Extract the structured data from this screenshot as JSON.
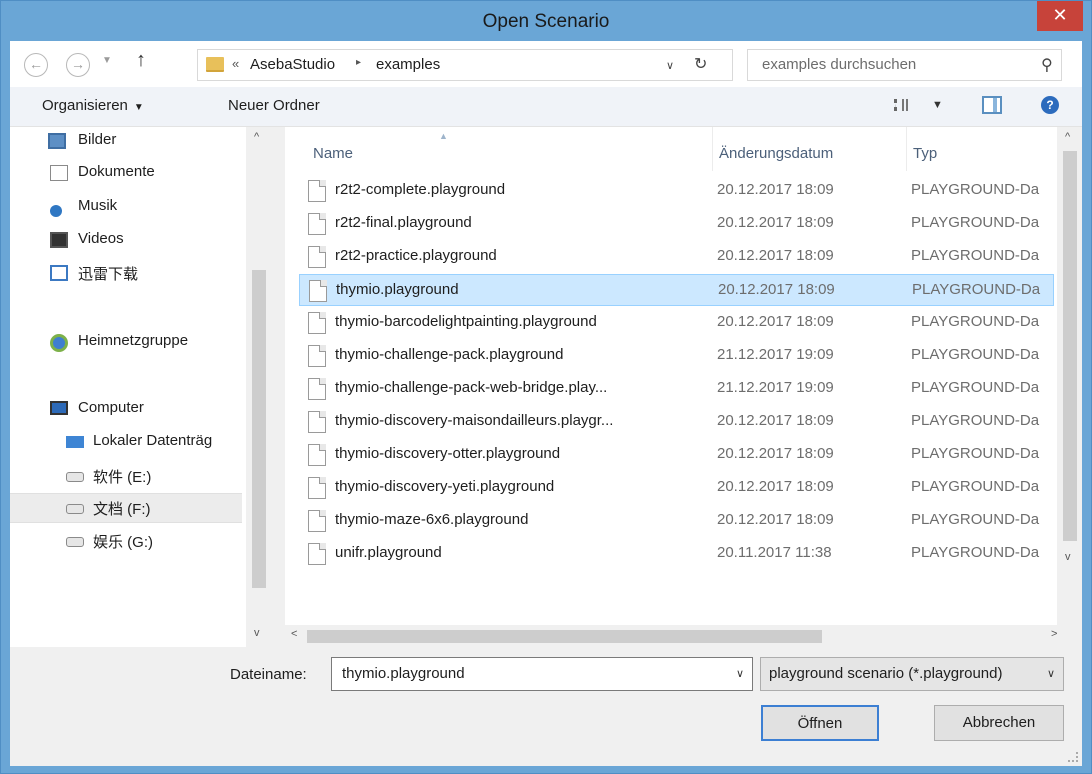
{
  "window": {
    "title": "Open Scenario",
    "close_glyph": "✕"
  },
  "address": {
    "back_glyph": "←",
    "forward_glyph": "→",
    "history_glyph": "▼",
    "up_glyph": "↑",
    "chevron": "«",
    "breadcrumbs": [
      "AsebaStudio",
      "examples"
    ],
    "separator": "▸",
    "dropdown_glyph": "∨",
    "refresh_glyph": "↻",
    "search_placeholder": "examples durchsuchen",
    "search_glyph": "⚲"
  },
  "toolbar": {
    "organize_label": "Organisieren",
    "organize_drop": "▼",
    "new_folder_label": "Neuer Ordner",
    "view_drop": "▼",
    "help_glyph": "?"
  },
  "sidebar": {
    "items": [
      {
        "label": "Bilder",
        "icon": "pictures-icon"
      },
      {
        "label": "Dokumente",
        "icon": "documents-icon"
      },
      {
        "label": "Musik",
        "icon": "music-icon"
      },
      {
        "label": "Videos",
        "icon": "videos-icon"
      },
      {
        "label": "迅雷下载",
        "icon": "download-folder-icon"
      },
      {
        "label": "Heimnetzgruppe",
        "icon": "homegroup-icon"
      },
      {
        "label": "Computer",
        "icon": "computer-icon"
      },
      {
        "label": "Lokaler Datenträg",
        "icon": "local-disk-icon"
      },
      {
        "label": "软件 (E:)",
        "icon": "drive-icon"
      },
      {
        "label": "文档 (F:)",
        "icon": "drive-icon"
      },
      {
        "label": "娱乐 (G:)",
        "icon": "drive-icon"
      }
    ],
    "selected": "文档 (F:)",
    "scroll_up": "^",
    "scroll_down": "v"
  },
  "files": {
    "columns": [
      "Name",
      "Änderungsdatum",
      "Typ"
    ],
    "sort_glyph": "▲",
    "rows": [
      {
        "name": "r2t2-complete.playground",
        "date": "20.12.2017 18:09",
        "type": "PLAYGROUND-Da"
      },
      {
        "name": "r2t2-final.playground",
        "date": "20.12.2017 18:09",
        "type": "PLAYGROUND-Da"
      },
      {
        "name": "r2t2-practice.playground",
        "date": "20.12.2017 18:09",
        "type": "PLAYGROUND-Da"
      },
      {
        "name": "thymio.playground",
        "date": "20.12.2017 18:09",
        "type": "PLAYGROUND-Da"
      },
      {
        "name": "thymio-barcodelightpainting.playground",
        "date": "20.12.2017 18:09",
        "type": "PLAYGROUND-Da"
      },
      {
        "name": "thymio-challenge-pack.playground",
        "date": "21.12.2017 19:09",
        "type": "PLAYGROUND-Da"
      },
      {
        "name": "thymio-challenge-pack-web-bridge.play...",
        "date": "21.12.2017 19:09",
        "type": "PLAYGROUND-Da"
      },
      {
        "name": "thymio-discovery-maisondailleurs.playgr...",
        "date": "20.12.2017 18:09",
        "type": "PLAYGROUND-Da"
      },
      {
        "name": "thymio-discovery-otter.playground",
        "date": "20.12.2017 18:09",
        "type": "PLAYGROUND-Da"
      },
      {
        "name": "thymio-discovery-yeti.playground",
        "date": "20.12.2017 18:09",
        "type": "PLAYGROUND-Da"
      },
      {
        "name": "thymio-maze-6x6.playground",
        "date": "20.12.2017 18:09",
        "type": "PLAYGROUND-Da"
      },
      {
        "name": "unifr.playground",
        "date": "20.11.2017 11:38",
        "type": "PLAYGROUND-Da"
      }
    ],
    "selected": "thymio.playground",
    "scroll_up": "^",
    "scroll_down": "v",
    "scroll_left": "<",
    "scroll_right": ">"
  },
  "footer": {
    "filename_label": "Dateiname:",
    "filename_value": "thymio.playground",
    "filename_drop": "∨",
    "filter_value": "playground scenario (*.playground)",
    "filter_drop": "∨",
    "open_label": "Öffnen",
    "cancel_label": "Abbrechen"
  }
}
